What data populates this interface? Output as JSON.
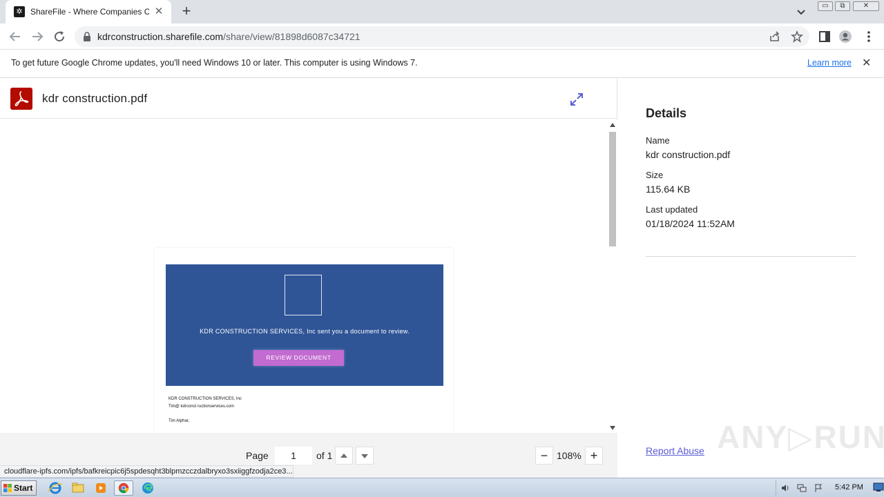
{
  "browser": {
    "tab": {
      "title": "ShareFile - Where Companies Conne",
      "close_glyph": "✕"
    },
    "new_tab_glyph": "+",
    "window_controls": {
      "minimize": "▭",
      "maximize": "⧉",
      "close": "✕"
    },
    "url_host": "kdrconstruction.sharefile.com",
    "url_path": "/share/view/81898d6087c34721",
    "infobar": {
      "message": "To get future Google Chrome updates, you'll need Windows 10 or later. This computer is using Windows 7.",
      "link": "Learn more",
      "close_glyph": "✕"
    },
    "status_url": "cloudflare-ipfs.com/ipfs/bafkreicpic6j5spdesqht3blpmzcczdalbryxo3sxiiggfzodja2ce3..."
  },
  "viewer": {
    "file_name": "kdr construction.pdf",
    "document": {
      "banner_text": "KDR CONSTRUCTION SERVICES, Inc sent you a document to review.",
      "button_label": "REVIEW DOCUMENT",
      "company_line": "KDR CONSTRUCTION SERVICES, Inc",
      "email_line": "Tim@ kdrconst ructionservices.com",
      "greeting": "Tim Atphar,"
    },
    "footer": {
      "page_label": "Page",
      "page_value": "1",
      "of_label": "of 1",
      "zoom_minus": "−",
      "zoom_value": "108%",
      "zoom_plus": "+"
    }
  },
  "details": {
    "title": "Details",
    "name_label": "Name",
    "name_value": "kdr construction.pdf",
    "size_label": "Size",
    "size_value": "115.64 KB",
    "updated_label": "Last updated",
    "updated_value": "01/18/2024 11:52AM",
    "report_link": "Report Abuse",
    "watermark": "ANY▷RUN"
  },
  "taskbar": {
    "start_label": "Start",
    "apps": [
      "internet-explorer-icon",
      "file-explorer-icon",
      "media-player-icon",
      "chrome-icon",
      "edge-icon"
    ],
    "clock": "5:42 PM"
  },
  "colors": {
    "banner_blue": "#2f5597",
    "review_button": "#c26bd0",
    "pdf_red": "#b30b00",
    "link_blue": "#1a73e8",
    "report_link": "#5b5bd6"
  }
}
